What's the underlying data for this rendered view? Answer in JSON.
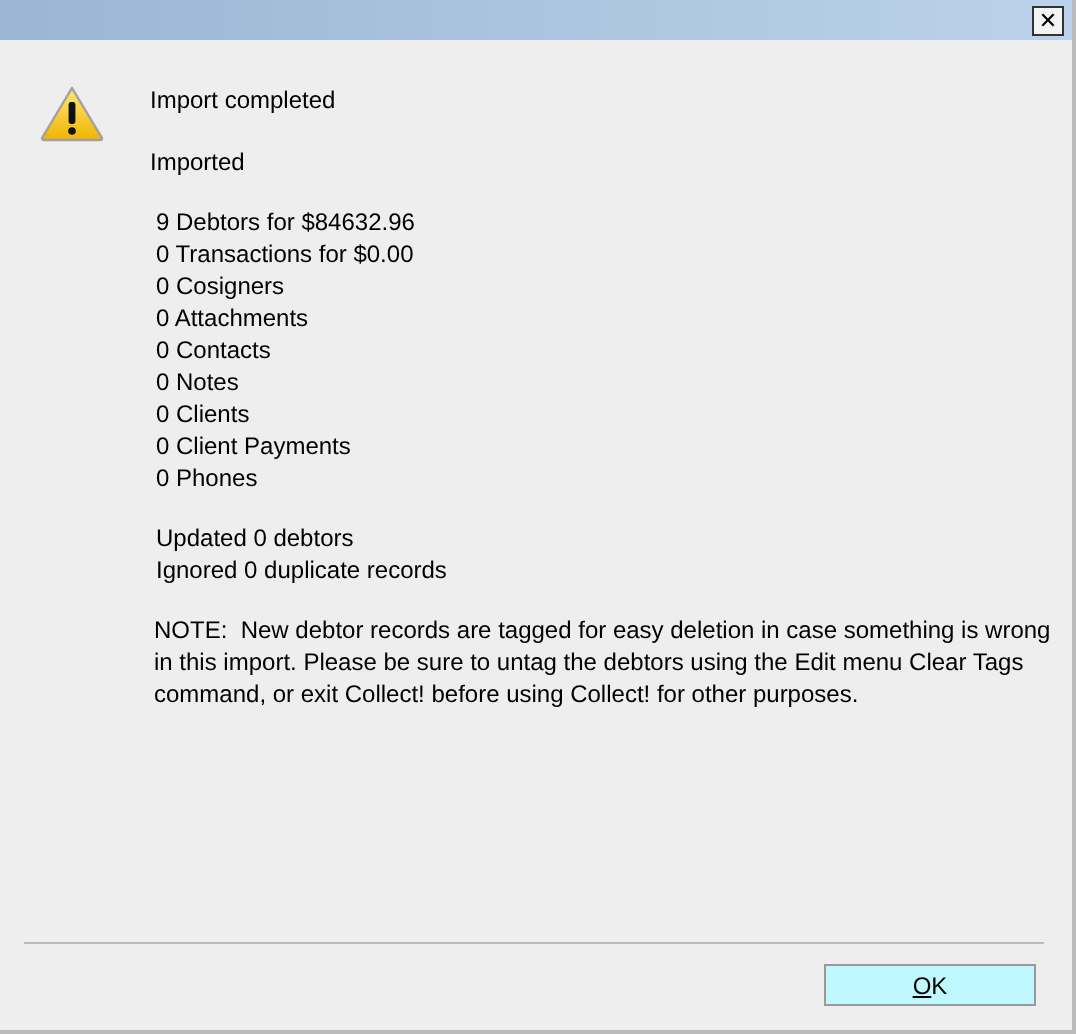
{
  "window": {
    "close_label": "✕"
  },
  "message": {
    "heading": "Import completed",
    "subheading": "Imported",
    "counts": [
      "9 Debtors for $84632.96",
      "0 Transactions for $0.00",
      "0 Cosigners",
      "0 Attachments",
      "0 Contacts",
      "0 Notes",
      "0 Clients",
      "0 Client Payments",
      "0 Phones"
    ],
    "summary": [
      "Updated 0 debtors",
      "Ignored 0 duplicate records"
    ],
    "note_label": "NOTE:",
    "note": "New debtor records are tagged for easy deletion in case something is wrong in this import. Please be sure to untag the debtors using the Edit menu Clear Tags command, or exit Collect! before using Collect! for other purposes."
  },
  "buttons": [
    "OK"
  ]
}
